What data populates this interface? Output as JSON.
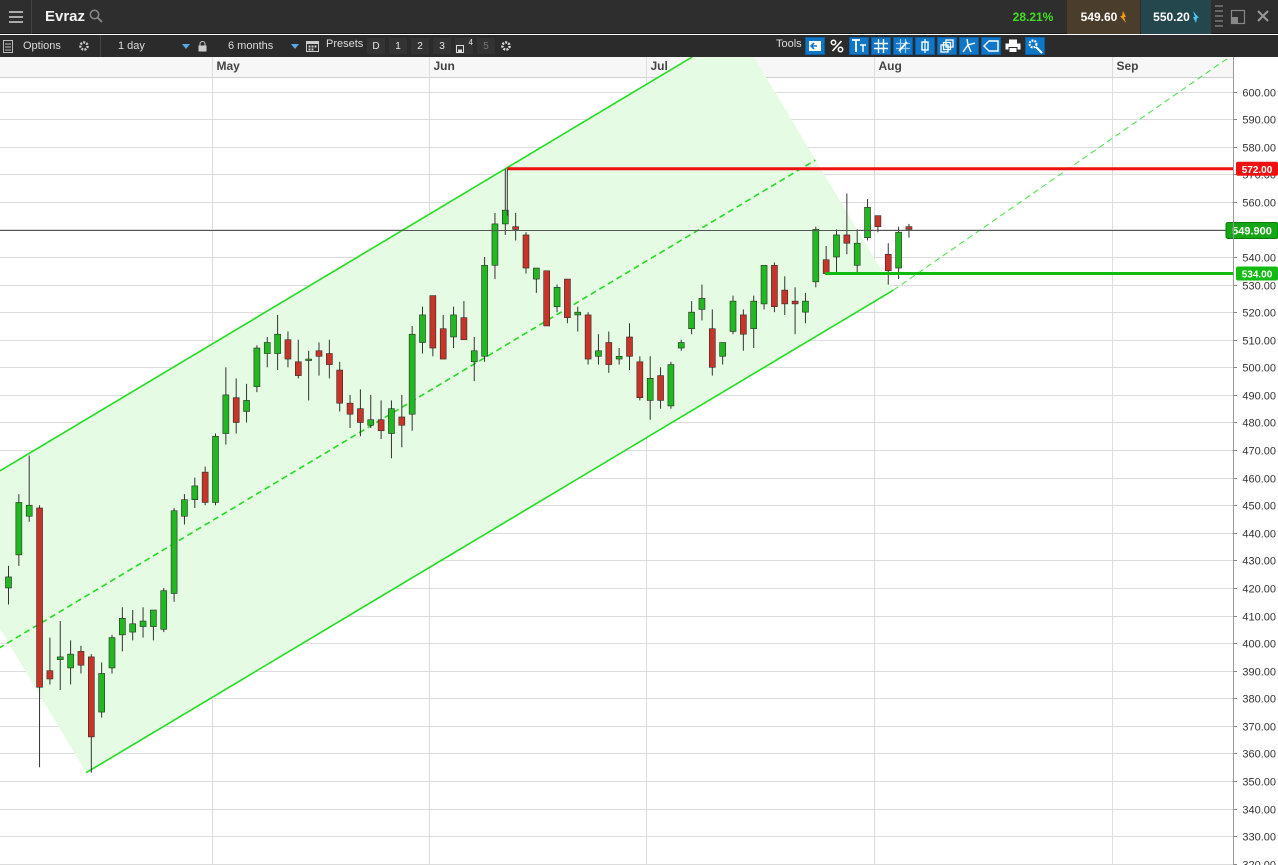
{
  "header": {
    "instrument": "Evraz",
    "change_pct": "28.21%",
    "sell_price": "549.60",
    "buy_price": "550.20"
  },
  "toolbar": {
    "options_label": "Options",
    "interval": "1 day",
    "period": "6 months",
    "presets_label": "Presets",
    "presets": [
      "D",
      "1",
      "2",
      "3",
      "4",
      "5"
    ],
    "tools_label": "Tools",
    "tool_icons": [
      "pointer-back-icon",
      "percent-icon",
      "text-tool-icon",
      "grid-icon",
      "crosshair-grid-icon",
      "candle-icon",
      "layers-icon",
      "fork-icon",
      "tag-icon",
      "print-icon",
      "settings-icon"
    ]
  },
  "colors": {
    "up": "#22b822",
    "down": "#c8342a",
    "channel": "#22dd22",
    "resistance": "#ee1111",
    "support": "#11bb11",
    "price_line": "#555555",
    "accent": "#0f76c8"
  },
  "chart_data": {
    "type": "candlestick",
    "months": [
      {
        "label": "May",
        "day": 20
      },
      {
        "label": "Jun",
        "day": 41
      },
      {
        "label": "Jul",
        "day": 62
      },
      {
        "label": "Aug",
        "day": 84
      },
      {
        "label": "Sep",
        "day": 107
      }
    ],
    "y_ticks": [
      "600.00",
      "590.00",
      "580.00",
      "570.00",
      "560.00",
      "550.00",
      "540.00",
      "530.00",
      "520.00",
      "510.00",
      "500.00",
      "490.00",
      "480.00",
      "470.00",
      "460.00",
      "450.00",
      "440.00",
      "430.00",
      "420.00",
      "410.00",
      "400.00",
      "390.00",
      "380.00",
      "370.00",
      "360.00",
      "350.00",
      "340.00",
      "330.00",
      "320.00"
    ],
    "ylim": [
      320,
      604
    ],
    "candles": [
      {
        "d": 0,
        "o": 420,
        "h": 428,
        "l": 414,
        "c": 424
      },
      {
        "d": 1,
        "o": 432,
        "h": 454,
        "l": 428,
        "c": 451
      },
      {
        "d": 2,
        "o": 446,
        "h": 468,
        "l": 444,
        "c": 450
      },
      {
        "d": 3,
        "o": 449,
        "h": 450,
        "l": 355,
        "c": 384
      },
      {
        "d": 4,
        "o": 390,
        "h": 402,
        "l": 385,
        "c": 387
      },
      {
        "d": 5,
        "o": 394,
        "h": 408,
        "l": 383,
        "c": 395
      },
      {
        "d": 6,
        "o": 391,
        "h": 401,
        "l": 385,
        "c": 396
      },
      {
        "d": 7,
        "o": 397,
        "h": 399,
        "l": 389,
        "c": 392
      },
      {
        "d": 8,
        "o": 395,
        "h": 396,
        "l": 353,
        "c": 366
      },
      {
        "d": 9,
        "o": 375,
        "h": 393,
        "l": 373,
        "c": 389
      },
      {
        "d": 10,
        "o": 391,
        "h": 403,
        "l": 389,
        "c": 402
      },
      {
        "d": 11,
        "o": 403,
        "h": 413,
        "l": 397,
        "c": 409
      },
      {
        "d": 12,
        "o": 404,
        "h": 412,
        "l": 401,
        "c": 407
      },
      {
        "d": 13,
        "o": 406,
        "h": 413,
        "l": 402,
        "c": 408
      },
      {
        "d": 14,
        "o": 406,
        "h": 412,
        "l": 401,
        "c": 412
      },
      {
        "d": 15,
        "o": 405,
        "h": 420,
        "l": 404,
        "c": 419
      },
      {
        "d": 16,
        "o": 418,
        "h": 449,
        "l": 415,
        "c": 448
      },
      {
        "d": 17,
        "o": 446,
        "h": 454,
        "l": 443,
        "c": 452
      },
      {
        "d": 18,
        "o": 452,
        "h": 460,
        "l": 449,
        "c": 457
      },
      {
        "d": 19,
        "o": 462,
        "h": 464,
        "l": 450,
        "c": 451
      },
      {
        "d": 20,
        "o": 451,
        "h": 476,
        "l": 450,
        "c": 475
      },
      {
        "d": 21,
        "o": 476,
        "h": 500,
        "l": 472,
        "c": 490
      },
      {
        "d": 22,
        "o": 489,
        "h": 496,
        "l": 476,
        "c": 480
      },
      {
        "d": 23,
        "o": 484,
        "h": 494,
        "l": 480,
        "c": 488
      },
      {
        "d": 24,
        "o": 493,
        "h": 508,
        "l": 491,
        "c": 507
      },
      {
        "d": 25,
        "o": 505,
        "h": 511,
        "l": 500,
        "c": 509
      },
      {
        "d": 26,
        "o": 505,
        "h": 519,
        "l": 499,
        "c": 512
      },
      {
        "d": 27,
        "o": 510,
        "h": 513,
        "l": 500,
        "c": 503
      },
      {
        "d": 28,
        "o": 502,
        "h": 510,
        "l": 496,
        "c": 497
      },
      {
        "d": 29,
        "o": 503,
        "h": 506,
        "l": 488,
        "c": 503
      },
      {
        "d": 30,
        "o": 506,
        "h": 509,
        "l": 497,
        "c": 504
      },
      {
        "d": 31,
        "o": 505,
        "h": 510,
        "l": 496,
        "c": 501
      },
      {
        "d": 32,
        "o": 499,
        "h": 502,
        "l": 484,
        "c": 487
      },
      {
        "d": 33,
        "o": 487,
        "h": 490,
        "l": 478,
        "c": 483
      },
      {
        "d": 34,
        "o": 485,
        "h": 492,
        "l": 475,
        "c": 480
      },
      {
        "d": 35,
        "o": 479,
        "h": 490,
        "l": 478,
        "c": 481
      },
      {
        "d": 36,
        "o": 481,
        "h": 488,
        "l": 474,
        "c": 477
      },
      {
        "d": 37,
        "o": 476,
        "h": 488,
        "l": 467,
        "c": 485
      },
      {
        "d": 38,
        "o": 482,
        "h": 490,
        "l": 471,
        "c": 479
      },
      {
        "d": 39,
        "o": 483,
        "h": 515,
        "l": 477,
        "c": 512
      },
      {
        "d": 40,
        "o": 509,
        "h": 522,
        "l": 505,
        "c": 519
      },
      {
        "d": 41,
        "o": 526,
        "h": 526,
        "l": 504,
        "c": 507
      },
      {
        "d": 42,
        "o": 514,
        "h": 519,
        "l": 503,
        "c": 503
      },
      {
        "d": 43,
        "o": 511,
        "h": 522,
        "l": 507,
        "c": 519
      },
      {
        "d": 44,
        "o": 518,
        "h": 524,
        "l": 510,
        "c": 510
      },
      {
        "d": 45,
        "o": 502,
        "h": 511,
        "l": 495,
        "c": 506
      },
      {
        "d": 46,
        "o": 504,
        "h": 540,
        "l": 502,
        "c": 537
      },
      {
        "d": 47,
        "o": 537,
        "h": 556,
        "l": 532,
        "c": 552
      },
      {
        "d": 48,
        "o": 552,
        "h": 572,
        "l": 548,
        "c": 557
      },
      {
        "d": 49,
        "o": 551,
        "h": 556,
        "l": 546,
        "c": 550
      },
      {
        "d": 50,
        "o": 548,
        "h": 549,
        "l": 534,
        "c": 536
      },
      {
        "d": 51,
        "o": 532,
        "h": 536,
        "l": 527,
        "c": 536
      },
      {
        "d": 52,
        "o": 535,
        "h": 535,
        "l": 515,
        "c": 515
      },
      {
        "d": 53,
        "o": 522,
        "h": 530,
        "l": 520,
        "c": 529
      },
      {
        "d": 54,
        "o": 532,
        "h": 532,
        "l": 516,
        "c": 518
      },
      {
        "d": 55,
        "o": 519,
        "h": 522,
        "l": 513,
        "c": 520
      },
      {
        "d": 56,
        "o": 519,
        "h": 520,
        "l": 501,
        "c": 503
      },
      {
        "d": 57,
        "o": 504,
        "h": 512,
        "l": 501,
        "c": 506
      },
      {
        "d": 58,
        "o": 509,
        "h": 513,
        "l": 498,
        "c": 501
      },
      {
        "d": 59,
        "o": 503,
        "h": 507,
        "l": 501,
        "c": 504
      },
      {
        "d": 60,
        "o": 511,
        "h": 516,
        "l": 499,
        "c": 504
      },
      {
        "d": 61,
        "o": 502,
        "h": 504,
        "l": 488,
        "c": 489
      },
      {
        "d": 62,
        "o": 488,
        "h": 504,
        "l": 481,
        "c": 496
      },
      {
        "d": 63,
        "o": 497,
        "h": 500,
        "l": 485,
        "c": 488
      },
      {
        "d": 64,
        "o": 486,
        "h": 502,
        "l": 485,
        "c": 501
      },
      {
        "d": 65,
        "o": 507,
        "h": 510,
        "l": 506,
        "c": 509
      },
      {
        "d": 66,
        "o": 514,
        "h": 524,
        "l": 512,
        "c": 520
      },
      {
        "d": 67,
        "o": 521,
        "h": 530,
        "l": 517,
        "c": 525
      },
      {
        "d": 68,
        "o": 514,
        "h": 521,
        "l": 497,
        "c": 500
      },
      {
        "d": 69,
        "o": 504,
        "h": 509,
        "l": 501,
        "c": 509
      },
      {
        "d": 70,
        "o": 513,
        "h": 526,
        "l": 512,
        "c": 524
      },
      {
        "d": 71,
        "o": 519,
        "h": 521,
        "l": 506,
        "c": 512
      },
      {
        "d": 72,
        "o": 514,
        "h": 526,
        "l": 507,
        "c": 524
      },
      {
        "d": 73,
        "o": 523,
        "h": 536,
        "l": 521,
        "c": 537
      },
      {
        "d": 74,
        "o": 537,
        "h": 538,
        "l": 520,
        "c": 522
      },
      {
        "d": 75,
        "o": 528,
        "h": 533,
        "l": 519,
        "c": 523
      },
      {
        "d": 76,
        "o": 524,
        "h": 529,
        "l": 512,
        "c": 523
      },
      {
        "d": 77,
        "o": 520,
        "h": 527,
        "l": 516,
        "c": 524
      },
      {
        "d": 78,
        "o": 531,
        "h": 551,
        "l": 529,
        "c": 550
      },
      {
        "d": 79,
        "o": 539,
        "h": 544,
        "l": 534,
        "c": 534
      },
      {
        "d": 80,
        "o": 540,
        "h": 550,
        "l": 534,
        "c": 548
      },
      {
        "d": 81,
        "o": 548,
        "h": 563,
        "l": 541,
        "c": 545
      },
      {
        "d": 82,
        "o": 537,
        "h": 550,
        "l": 534,
        "c": 545
      },
      {
        "d": 83,
        "o": 547,
        "h": 561,
        "l": 546,
        "c": 558
      },
      {
        "d": 84,
        "o": 555,
        "h": 554,
        "l": 549,
        "c": 551
      },
      {
        "d": 85,
        "o": 541,
        "h": 545,
        "l": 530,
        "c": 535
      },
      {
        "d": 86,
        "o": 536,
        "h": 551,
        "l": 532,
        "c": 549
      },
      {
        "d": 87,
        "o": 551,
        "h": 552,
        "l": 547,
        "c": 550
      }
    ],
    "channel": {
      "anchor_low": {
        "d": 7.5,
        "y": 353
      },
      "anchor_high": {
        "d": 48,
        "y": 572
      },
      "anchor_low2": {
        "d": 85.5,
        "y": 528
      }
    },
    "levels": [
      {
        "name": "resistance",
        "value": 572,
        "label": "572.00",
        "from_d": 48
      },
      {
        "name": "support",
        "value": 534,
        "label": "534.00",
        "from_d": 79
      }
    ],
    "last_price": {
      "value": 549.9,
      "label": "549.900"
    }
  }
}
